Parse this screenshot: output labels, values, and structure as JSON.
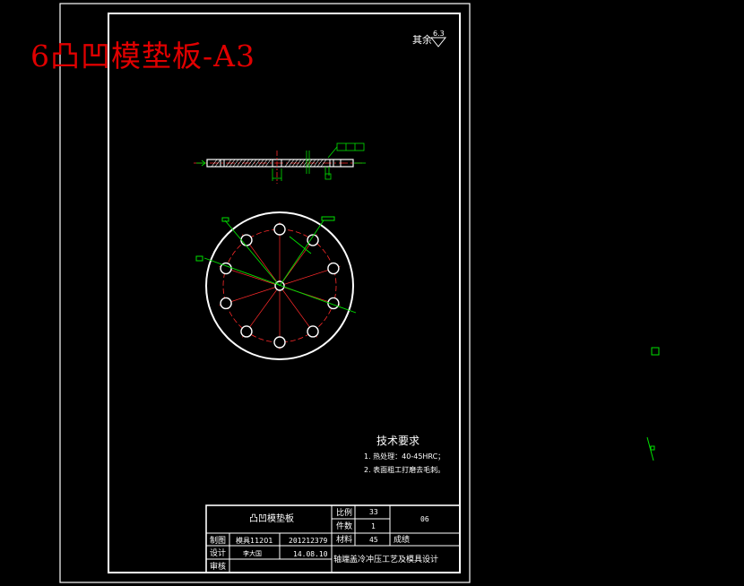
{
  "overlay_title": "6凸凹模垫板-A3",
  "roughness": {
    "prefix": "其余",
    "value": "6.3"
  },
  "tech_requirements": {
    "title": "技术要求",
    "items": [
      "1. 热处理：40-45HRC；",
      "2. 表面粗工打磨去毛刺。"
    ]
  },
  "title_block": {
    "part_name": "凸凹模垫板",
    "scale_label": "比例",
    "scale_value": "33",
    "qty_label": "件数",
    "qty_value": "1",
    "material_label": "材料",
    "material_value": "45",
    "sheet_no": "06",
    "grade_label": "成绩",
    "design_label": "制图",
    "class_value": "模具11201",
    "student_id": "201212379",
    "designer_label": "设计",
    "designer_name": "李大国",
    "date_value": "14.08.10",
    "review_label": "审核",
    "project_title": "轴端盖冷冲压工艺及模具设计"
  },
  "colors": {
    "background": "#000000",
    "line": "#ffffff",
    "center_line": "#ff2a2a",
    "dimension": "#00e000",
    "title_red": "#e00000"
  }
}
